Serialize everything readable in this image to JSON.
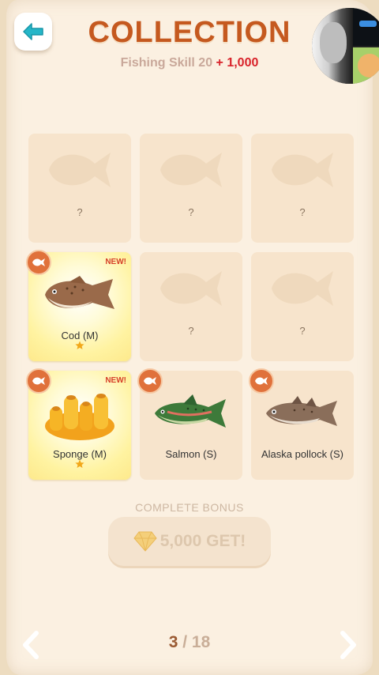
{
  "header": {
    "title": "COLLECTION",
    "skill_label": "Fishing Skill",
    "skill_value": "20",
    "skill_bonus": "+ 1,000"
  },
  "collection": {
    "slots": [
      {
        "label": "?",
        "discovered": false
      },
      {
        "label": "?",
        "discovered": false
      },
      {
        "label": "?",
        "discovered": false
      },
      {
        "label": "Cod (M)",
        "discovered": true,
        "new_tag": "NEW!",
        "stars": 1
      },
      {
        "label": "?",
        "discovered": false
      },
      {
        "label": "?",
        "discovered": false
      },
      {
        "label": "Sponge (M)",
        "discovered": true,
        "new_tag": "NEW!",
        "stars": 1
      },
      {
        "label": "Salmon (S)",
        "discovered": true
      },
      {
        "label": "Alaska pollock (S)",
        "discovered": true
      }
    ]
  },
  "bonus": {
    "label": "COMPLETE BONUS",
    "amount": "5,000 GET!"
  },
  "pager": {
    "current": "3",
    "separator": "/",
    "total": "18"
  },
  "colors": {
    "title": "#c5591f",
    "skill_bonus": "#d8222a",
    "badge": "#e0713b",
    "new_tag": "#d6402a"
  },
  "icons": {
    "back": "back-arrow-icon",
    "badge": "fish-badge-icon",
    "gem": "diamond-icon",
    "prev": "chevron-left-icon",
    "next": "chevron-right-icon"
  }
}
